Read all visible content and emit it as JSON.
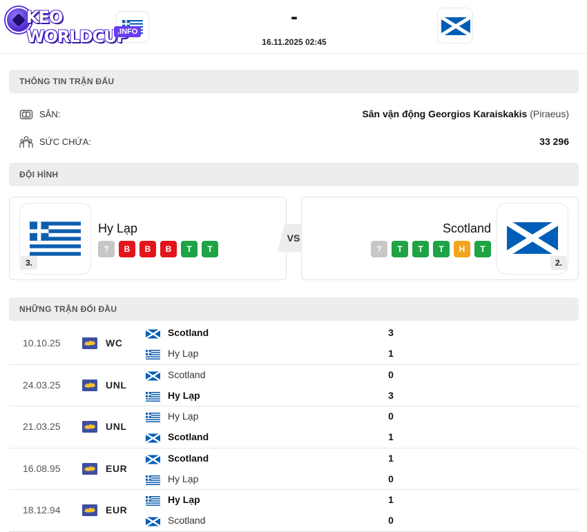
{
  "header": {
    "logo_word": "KEO WORLDCUP",
    "logo_tld": ".INFO",
    "score": "-",
    "kickoff": "16.11.2025 02:45"
  },
  "match_info": {
    "title": "THÔNG TIN TRẬN ĐẤU",
    "stadium_label": "SÂN:",
    "stadium_name": "Sân vận động Georgios Karaiskakis",
    "stadium_city": "(Piraeus)",
    "capacity_label": "SỨC CHỨA:",
    "capacity_value": "33 296"
  },
  "lineup": {
    "title": "ĐỘI HÌNH",
    "vs": "VS",
    "home": {
      "name": "Hy Lạp",
      "rank": "3.",
      "form": [
        "?",
        "B",
        "B",
        "B",
        "T",
        "T"
      ]
    },
    "away": {
      "name": "Scotland",
      "rank": "2.",
      "form": [
        "?",
        "T",
        "T",
        "T",
        "H",
        "T"
      ]
    }
  },
  "h2h": {
    "title": "NHỮNG TRẬN ĐỐI ĐẦU",
    "matches": [
      {
        "date": "10.10.25",
        "comp": "WC",
        "top": {
          "team": "Scotland",
          "flag": "scotland",
          "score": "3",
          "win": true
        },
        "bottom": {
          "team": "Hy Lạp",
          "flag": "greece",
          "score": "1",
          "win": false
        }
      },
      {
        "date": "24.03.25",
        "comp": "UNL",
        "top": {
          "team": "Scotland",
          "flag": "scotland",
          "score": "0",
          "win": false
        },
        "bottom": {
          "team": "Hy Lạp",
          "flag": "greece",
          "score": "3",
          "win": true
        }
      },
      {
        "date": "21.03.25",
        "comp": "UNL",
        "top": {
          "team": "Hy Lạp",
          "flag": "greece",
          "score": "0",
          "win": false
        },
        "bottom": {
          "team": "Scotland",
          "flag": "scotland",
          "score": "1",
          "win": true
        }
      },
      {
        "date": "16.08.95",
        "comp": "EUR",
        "top": {
          "team": "Scotland",
          "flag": "scotland",
          "score": "1",
          "win": true
        },
        "bottom": {
          "team": "Hy Lạp",
          "flag": "greece",
          "score": "0",
          "win": false
        }
      },
      {
        "date": "18.12.94",
        "comp": "EUR",
        "top": {
          "team": "Hy Lạp",
          "flag": "greece",
          "score": "1",
          "win": true
        },
        "bottom": {
          "team": "Scotland",
          "flag": "scotland",
          "score": "0",
          "win": false
        }
      }
    ]
  },
  "colors": {
    "loss": "#e3141a",
    "win": "#1ea345",
    "draw": "#f4a51e",
    "unknown": "#c7c7c7",
    "greece_blue": "#0d5eaf",
    "scotland_blue": "#005eb8"
  }
}
